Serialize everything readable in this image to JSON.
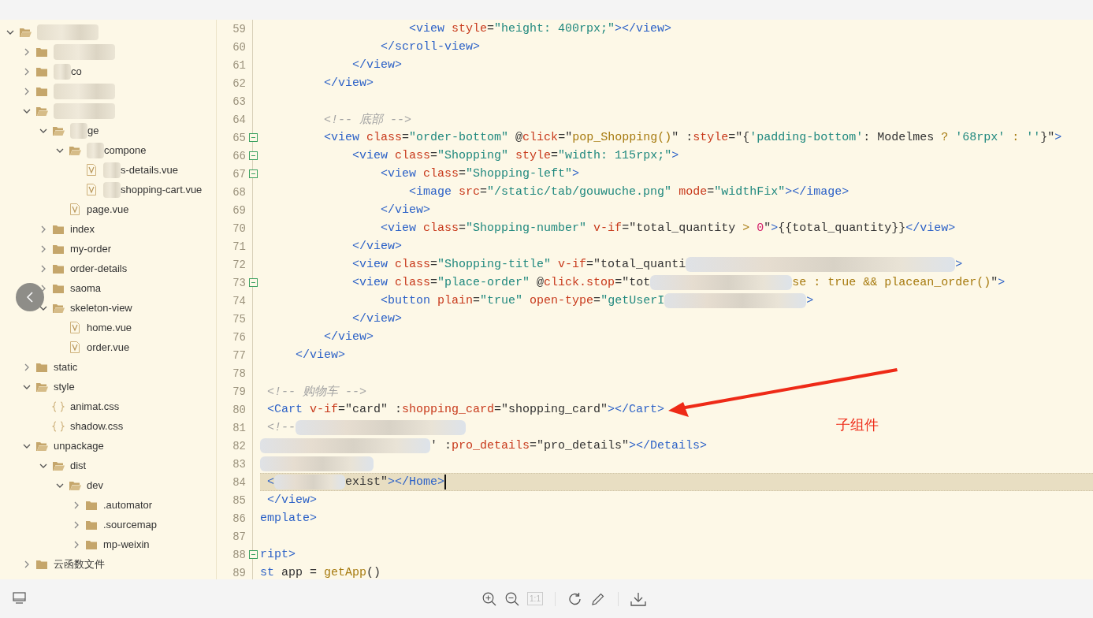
{
  "file_tree": [
    {
      "kind": "folder",
      "expanded": true,
      "blurred": true,
      "children": [
        {
          "kind": "folder",
          "expanded": false,
          "blurred": true
        },
        {
          "kind": "folder",
          "expanded": false,
          "blurred": true,
          "name": "co"
        },
        {
          "kind": "folder",
          "expanded": false,
          "blurred": true
        },
        {
          "kind": "folder",
          "expanded": true,
          "blurred": true,
          "children": [
            {
              "kind": "folder",
              "expanded": true,
              "blurred": true,
              "name": "ge",
              "children": [
                {
                  "kind": "folder",
                  "expanded": true,
                  "blurred": true,
                  "name": "compone",
                  "children": [
                    {
                      "kind": "vue",
                      "blurred": true,
                      "name": "s-details.vue"
                    },
                    {
                      "kind": "vue",
                      "blurred": true,
                      "name": "shopping-cart.vue"
                    }
                  ]
                },
                {
                  "kind": "vue",
                  "blurred": false,
                  "name": "page.vue"
                }
              ]
            },
            {
              "kind": "folder",
              "expanded": false,
              "blurred": false,
              "name": "index"
            },
            {
              "kind": "folder",
              "expanded": false,
              "blurred": false,
              "name": "my-order"
            },
            {
              "kind": "folder",
              "expanded": false,
              "blurred": false,
              "name": "order-details"
            },
            {
              "kind": "folder",
              "expanded": false,
              "blurred": false,
              "name": "saoma"
            },
            {
              "kind": "folder",
              "expanded": true,
              "blurred": false,
              "name": "skeleton-view",
              "children": [
                {
                  "kind": "vue",
                  "blurred": false,
                  "name": "home.vue"
                },
                {
                  "kind": "vue",
                  "blurred": false,
                  "name": "order.vue"
                }
              ]
            }
          ]
        },
        {
          "kind": "folder",
          "expanded": false,
          "blurred": false,
          "name": "static"
        },
        {
          "kind": "folder",
          "expanded": true,
          "blurred": false,
          "name": "style",
          "children": [
            {
              "kind": "css",
              "blurred": false,
              "name": "animat.css"
            },
            {
              "kind": "css",
              "blurred": false,
              "name": "shadow.css"
            }
          ]
        },
        {
          "kind": "folder",
          "expanded": true,
          "blurred": false,
          "name": "unpackage",
          "children": [
            {
              "kind": "folder",
              "expanded": true,
              "blurred": false,
              "name": "dist",
              "children": [
                {
                  "kind": "folder",
                  "expanded": true,
                  "blurred": false,
                  "name": "dev",
                  "children": [
                    {
                      "kind": "folder",
                      "expanded": false,
                      "blurred": false,
                      "name": ".automator"
                    },
                    {
                      "kind": "folder",
                      "expanded": false,
                      "blurred": false,
                      "name": ".sourcemap"
                    },
                    {
                      "kind": "folder",
                      "expanded": false,
                      "blurred": false,
                      "name": "mp-weixin"
                    }
                  ]
                }
              ]
            }
          ]
        },
        {
          "kind": "folder",
          "expanded": false,
          "blurred": false,
          "name": "云函数文件"
        }
      ]
    }
  ],
  "editor": {
    "lines": [
      {
        "number": "59",
        "fold": false,
        "highlighted": false,
        "caret": false,
        "tokens": [
          {
            "kind": "tag",
            "text": "                     <view"
          },
          {
            "kind": "attr",
            "text": " style"
          },
          {
            "kind": "plain",
            "text": "="
          },
          {
            "kind": "str",
            "text": "\"height: 400rpx;\""
          },
          {
            "kind": "tag",
            "text": "></view>"
          }
        ]
      },
      {
        "number": "60",
        "fold": false,
        "highlighted": false,
        "caret": false,
        "tokens": [
          {
            "kind": "tag",
            "text": "                 </scroll-view>"
          }
        ]
      },
      {
        "number": "61",
        "fold": false,
        "highlighted": false,
        "caret": false,
        "tokens": [
          {
            "kind": "tag",
            "text": "             </view>"
          }
        ]
      },
      {
        "number": "62",
        "fold": false,
        "highlighted": false,
        "caret": false,
        "tokens": [
          {
            "kind": "tag",
            "text": "         </view>"
          }
        ]
      },
      {
        "number": "63",
        "fold": false,
        "highlighted": false,
        "caret": false
      },
      {
        "number": "64",
        "fold": false,
        "highlighted": false,
        "caret": false,
        "tokens": [
          {
            "kind": "comment",
            "text": "         <!-- 底部 -->"
          }
        ]
      },
      {
        "number": "65",
        "fold": true,
        "highlighted": false,
        "caret": false,
        "tokens": [
          {
            "kind": "tag",
            "text": "         <view"
          },
          {
            "kind": "attr",
            "text": " class"
          },
          {
            "kind": "plain",
            "text": "="
          },
          {
            "kind": "str",
            "text": "\"order-bottom\""
          },
          {
            "kind": "plain",
            "text": " @"
          },
          {
            "kind": "attr",
            "text": "click"
          },
          {
            "kind": "plain",
            "text": "=\""
          },
          {
            "kind": "expr",
            "text": "pop_Shopping()"
          },
          {
            "kind": "plain",
            "text": "\" :"
          },
          {
            "kind": "attr",
            "text": "style"
          },
          {
            "kind": "plain",
            "text": "=\"{"
          },
          {
            "kind": "str",
            "text": "'padding-bottom'"
          },
          {
            "kind": "plain",
            "text": ": Modelmes"
          },
          {
            "kind": "expr",
            "text": " ?"
          },
          {
            "kind": "str",
            "text": " '68rpx'"
          },
          {
            "kind": "expr",
            "text": " :"
          },
          {
            "kind": "str",
            "text": " ''"
          },
          {
            "kind": "plain",
            "text": "}\""
          },
          {
            "kind": "tag",
            "text": ">"
          }
        ]
      },
      {
        "number": "66",
        "fold": true,
        "highlighted": false,
        "caret": false,
        "tokens": [
          {
            "kind": "tag",
            "text": "             <view"
          },
          {
            "kind": "attr",
            "text": " class"
          },
          {
            "kind": "plain",
            "text": "="
          },
          {
            "kind": "str",
            "text": "\"Shopping\""
          },
          {
            "kind": "attr",
            "text": " style"
          },
          {
            "kind": "plain",
            "text": "="
          },
          {
            "kind": "str",
            "text": "\"width: 115rpx;\""
          },
          {
            "kind": "tag",
            "text": ">"
          }
        ]
      },
      {
        "number": "67",
        "fold": true,
        "highlighted": false,
        "caret": false,
        "tokens": [
          {
            "kind": "tag",
            "text": "                 <view"
          },
          {
            "kind": "attr",
            "text": " class"
          },
          {
            "kind": "plain",
            "text": "="
          },
          {
            "kind": "str",
            "text": "\"Shopping-left\""
          },
          {
            "kind": "tag",
            "text": ">"
          }
        ]
      },
      {
        "number": "68",
        "fold": false,
        "highlighted": false,
        "caret": false,
        "tokens": [
          {
            "kind": "tag",
            "text": "                     <image"
          },
          {
            "kind": "attr",
            "text": " src"
          },
          {
            "kind": "plain",
            "text": "="
          },
          {
            "kind": "str",
            "text": "\"/static/tab/gouwuche.png\""
          },
          {
            "kind": "attr",
            "text": " mode"
          },
          {
            "kind": "plain",
            "text": "="
          },
          {
            "kind": "str",
            "text": "\"widthFix\""
          },
          {
            "kind": "tag",
            "text": "></image>"
          }
        ]
      },
      {
        "number": "69",
        "fold": false,
        "highlighted": false,
        "caret": false,
        "tokens": [
          {
            "kind": "tag",
            "text": "                 </view>"
          }
        ]
      },
      {
        "number": "70",
        "fold": false,
        "highlighted": false,
        "caret": false,
        "tokens": [
          {
            "kind": "tag",
            "text": "                 <view"
          },
          {
            "kind": "attr",
            "text": " class"
          },
          {
            "kind": "plain",
            "text": "="
          },
          {
            "kind": "str",
            "text": "\"Shopping-number\""
          },
          {
            "kind": "attr",
            "text": " v-if"
          },
          {
            "kind": "plain",
            "text": "=\"total_quantity"
          },
          {
            "kind": "expr",
            "text": " >"
          },
          {
            "kind": "num",
            "text": " 0"
          },
          {
            "kind": "plain",
            "text": "\""
          },
          {
            "kind": "tag",
            "text": ">"
          },
          {
            "kind": "plain",
            "text": "{{total_quantity}}"
          },
          {
            "kind": "tag",
            "text": "</view>"
          }
        ]
      },
      {
        "number": "71",
        "fold": false,
        "highlighted": false,
        "caret": false,
        "tokens": [
          {
            "kind": "tag",
            "text": "             </view>"
          }
        ]
      },
      {
        "number": "72",
        "fold": false,
        "highlighted": false,
        "caret": false,
        "tokens": [
          {
            "kind": "tag",
            "text": "             <view"
          },
          {
            "kind": "attr",
            "text": " class"
          },
          {
            "kind": "plain",
            "text": "="
          },
          {
            "kind": "str",
            "text": "\"Shopping-title\""
          },
          {
            "kind": "attr",
            "text": " v-if"
          },
          {
            "kind": "plain",
            "text": "=\"total_quanti"
          },
          {
            "kind": "blurhuge"
          },
          {
            "kind": "tag",
            "text": ">"
          }
        ]
      },
      {
        "number": "73",
        "fold": true,
        "highlighted": false,
        "caret": false,
        "tokens": [
          {
            "kind": "tag",
            "text": "             <view"
          },
          {
            "kind": "attr",
            "text": " class"
          },
          {
            "kind": "plain",
            "text": "="
          },
          {
            "kind": "str",
            "text": "\"place-order\""
          },
          {
            "kind": "plain",
            "text": " @"
          },
          {
            "kind": "attr",
            "text": "click.stop"
          },
          {
            "kind": "plain",
            "text": "=\"tot"
          },
          {
            "kind": "blurlong"
          },
          {
            "kind": "expr",
            "text": "se : true && placean_order()"
          },
          {
            "kind": "plain",
            "text": "\""
          },
          {
            "kind": "tag",
            "text": ">"
          }
        ]
      },
      {
        "number": "74",
        "fold": false,
        "highlighted": false,
        "caret": false,
        "tokens": [
          {
            "kind": "tag",
            "text": "                 <button"
          },
          {
            "kind": "attr",
            "text": " plain"
          },
          {
            "kind": "plain",
            "text": "="
          },
          {
            "kind": "str",
            "text": "\"true\""
          },
          {
            "kind": "attr",
            "text": " open-type"
          },
          {
            "kind": "plain",
            "text": "="
          },
          {
            "kind": "str",
            "text": "\"getUserI"
          },
          {
            "kind": "blurlong"
          },
          {
            "kind": "tag",
            "text": ">"
          }
        ]
      },
      {
        "number": "75",
        "fold": false,
        "highlighted": false,
        "caret": false,
        "tokens": [
          {
            "kind": "tag",
            "text": "             </view>"
          }
        ]
      },
      {
        "number": "76",
        "fold": false,
        "highlighted": false,
        "caret": false,
        "tokens": [
          {
            "kind": "tag",
            "text": "         </view>"
          }
        ]
      },
      {
        "number": "77",
        "fold": false,
        "highlighted": false,
        "caret": false,
        "tokens": [
          {
            "kind": "tag",
            "text": "     </view>"
          }
        ]
      },
      {
        "number": "78",
        "fold": false,
        "highlighted": false,
        "caret": false
      },
      {
        "number": "79",
        "fold": false,
        "highlighted": false,
        "caret": false,
        "tokens": [
          {
            "kind": "comment",
            "text": " <!-- 购物车 -->"
          }
        ]
      },
      {
        "number": "80",
        "fold": false,
        "highlighted": false,
        "caret": false,
        "tokens": [
          {
            "kind": "tag",
            "text": " <Cart"
          },
          {
            "kind": "attr",
            "text": " v-if"
          },
          {
            "kind": "plain",
            "text": "=\"card\" :"
          },
          {
            "kind": "attr",
            "text": "shopping_card"
          },
          {
            "kind": "plain",
            "text": "=\"shopping_card\""
          },
          {
            "kind": "tag",
            "text": "></Cart>"
          }
        ]
      },
      {
        "number": "81",
        "fold": false,
        "highlighted": false,
        "caret": false,
        "tokens": [
          {
            "kind": "comment",
            "text": " <!--"
          },
          {
            "kind": "blurwide"
          }
        ]
      },
      {
        "number": "82",
        "fold": false,
        "highlighted": false,
        "caret": false,
        "tokens": [
          {
            "kind": "blurwide"
          },
          {
            "kind": "plain",
            "text": "' :"
          },
          {
            "kind": "attr",
            "text": "pro_details"
          },
          {
            "kind": "plain",
            "text": "=\"pro_details\""
          },
          {
            "kind": "tag",
            "text": "></Details>"
          }
        ]
      },
      {
        "number": "83",
        "fold": false,
        "highlighted": false,
        "caret": false,
        "tokens": [
          {
            "kind": "blurmedium"
          }
        ]
      },
      {
        "number": "84",
        "fold": false,
        "highlighted": true,
        "caret": true,
        "tokens": [
          {
            "kind": "tag",
            "text": " <"
          },
          {
            "kind": "blurshort"
          },
          {
            "kind": "plain",
            "text": "exist\""
          },
          {
            "kind": "tag",
            "text": "></Home>"
          }
        ]
      },
      {
        "number": "85",
        "fold": false,
        "highlighted": false,
        "caret": false,
        "tokens": [
          {
            "kind": "tag",
            "text": " </view>"
          }
        ]
      },
      {
        "number": "86",
        "fold": false,
        "highlighted": false,
        "caret": false,
        "tokens": [
          {
            "kind": "tag",
            "text": "emplate>"
          }
        ]
      },
      {
        "number": "87",
        "fold": false,
        "highlighted": false,
        "caret": false
      },
      {
        "number": "88",
        "fold": true,
        "highlighted": false,
        "caret": false,
        "tokens": [
          {
            "kind": "tag",
            "text": "ript>"
          }
        ]
      },
      {
        "number": "89",
        "fold": false,
        "highlighted": false,
        "caret": false,
        "tokens": [
          {
            "kind": "tag",
            "text": "st"
          },
          {
            "kind": "plain",
            "text": " app ="
          },
          {
            "kind": "expr",
            "text": " getApp"
          },
          {
            "kind": "plain",
            "text": "()"
          }
        ]
      }
    ]
  },
  "annotation": {
    "label": "子组件"
  },
  "toolbar": {
    "actual_size": {
      "label": "1:1",
      "disabled": true
    }
  }
}
